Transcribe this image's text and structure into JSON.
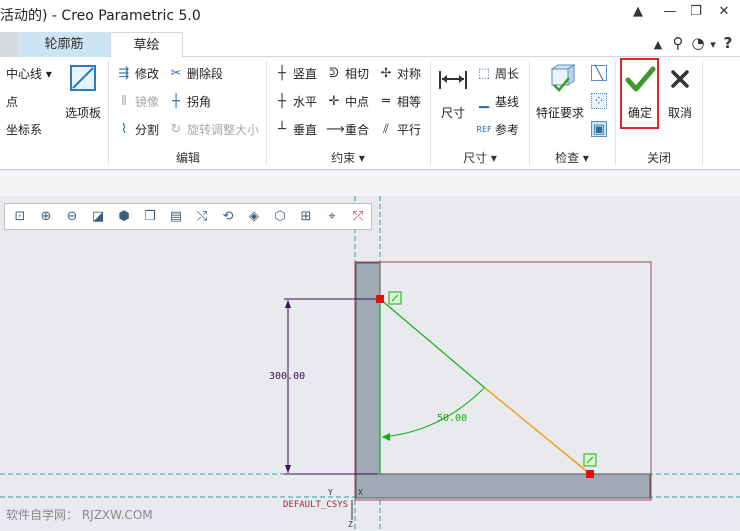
{
  "window": {
    "title": "活动的) - Creo Parametric 5.0",
    "controls": [
      "▲",
      "—",
      "❐",
      "✕"
    ]
  },
  "tabs": [
    {
      "label": "轮廓筋"
    },
    {
      "label": "草绘"
    }
  ],
  "tab_icons": [
    "▲",
    "⚲",
    "◔",
    "▾",
    "?"
  ],
  "ribbon": {
    "left_col": [
      "中心线 ▾",
      "点",
      "坐标系"
    ],
    "option_panel": "选项板",
    "edit": {
      "items": [
        "修改",
        "删除段",
        "镜像",
        "拐角",
        "分割",
        "旋转调整大小"
      ],
      "label": "编辑"
    },
    "constraint": {
      "items": [
        "竖直",
        "相切",
        "对称",
        "水平",
        "中点",
        "相等",
        "垂直",
        "重合",
        "平行"
      ],
      "label": "约束 ▾"
    },
    "dimension": {
      "big": "尺寸",
      "items": [
        "周长",
        "基线",
        "参考"
      ],
      "label": "尺寸 ▾"
    },
    "inspect": {
      "big": "特征要求",
      "label": "检查 ▾"
    },
    "close": {
      "ok": "确定",
      "cancel": "取消",
      "label": "关闭"
    }
  },
  "sketch": {
    "dim_vertical": "300.00",
    "dim_angle": "50.00",
    "csys_label": "DEFAULT_CSYS",
    "axis_y": "Y",
    "axis_x": "X",
    "axis_z": "Z"
  },
  "watermark": "软件自学网： RJZXW.COM",
  "colors": {
    "ok_border": "#e2252b",
    "check_green": "#3a9a2a",
    "sketch_green": "#10b010",
    "sketch_orange": "#f0a020",
    "dim_purple": "#3a1050",
    "section_fill": "#a0aab4",
    "boundary": "#9a4a5a",
    "axis_cyan": "#30a0a0"
  }
}
